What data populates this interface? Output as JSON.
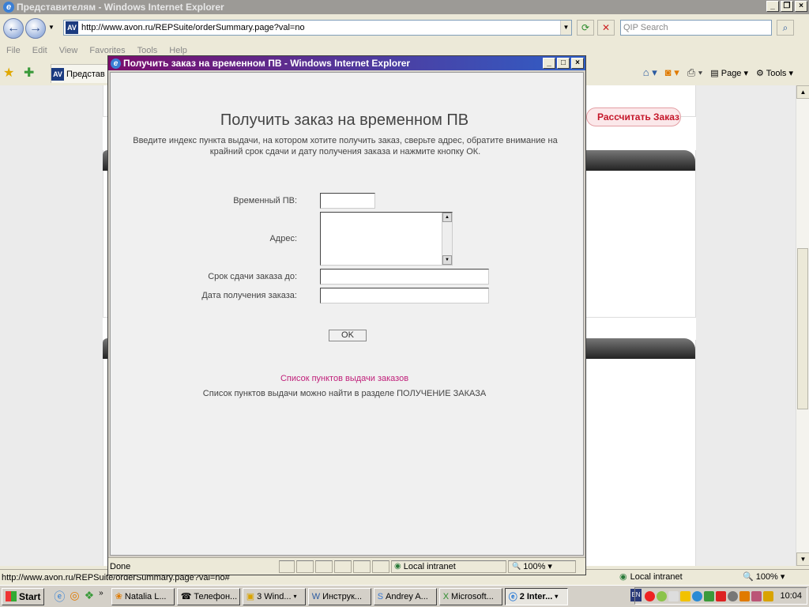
{
  "main_window": {
    "title": "Представителям - Windows Internet Explorer",
    "url": "http://www.avon.ru/REPSuite/orderSummary.page?val=no",
    "search_placeholder": "QIP Search",
    "menu": [
      "File",
      "Edit",
      "View",
      "Favorites",
      "Tools",
      "Help"
    ],
    "tab_label": "Представ",
    "toolbar": {
      "page_label": "Page",
      "tools_label": "Tools"
    },
    "page_button": "Рассчитать Заказ",
    "status": {
      "text": "http://www.avon.ru/REPSuite/orderSummary.page?val=no#",
      "zone": "Local intranet",
      "zoom": "100%"
    }
  },
  "popup": {
    "window_title": "Получить заказ на временном ПВ - Windows Internet Explorer",
    "heading": "Получить заказ на временном ПВ",
    "intro": "Введите индекс пункта выдачи, на котором хотите получить заказ, сверьте адрес, обратите внимание на крайний срок сдачи и дату получения заказа и нажмите кнопку ОК.",
    "fields": {
      "temp_pv_label": "Временный ПВ:",
      "address_label": "Адрес:",
      "deadline_label": "Срок сдачи заказа до:",
      "receive_date_label": "Дата получения заказа:"
    },
    "ok_label": "OK",
    "list_link": "Список пунктов выдачи заказов",
    "note": "Список пунктов выдачи можно найти в разделе ПОЛУЧЕНИЕ ЗАКАЗА",
    "status": {
      "text": "Done",
      "zone": "Local intranet",
      "zoom": "100%"
    }
  },
  "taskbar": {
    "start_label": "Start",
    "tasks": [
      "Natalia L...",
      "Телефон...",
      "3 Wind...",
      "Инструк...",
      "Andrey A...",
      "Microsoft...",
      "2 Inter..."
    ],
    "lang": "EN",
    "clock": "10:04"
  },
  "colors": {
    "popup_title_start": "#7a0d6c",
    "popup_title_end": "#2f5fc7",
    "link": "#c0207a",
    "page_button_text": "#c5172a"
  }
}
